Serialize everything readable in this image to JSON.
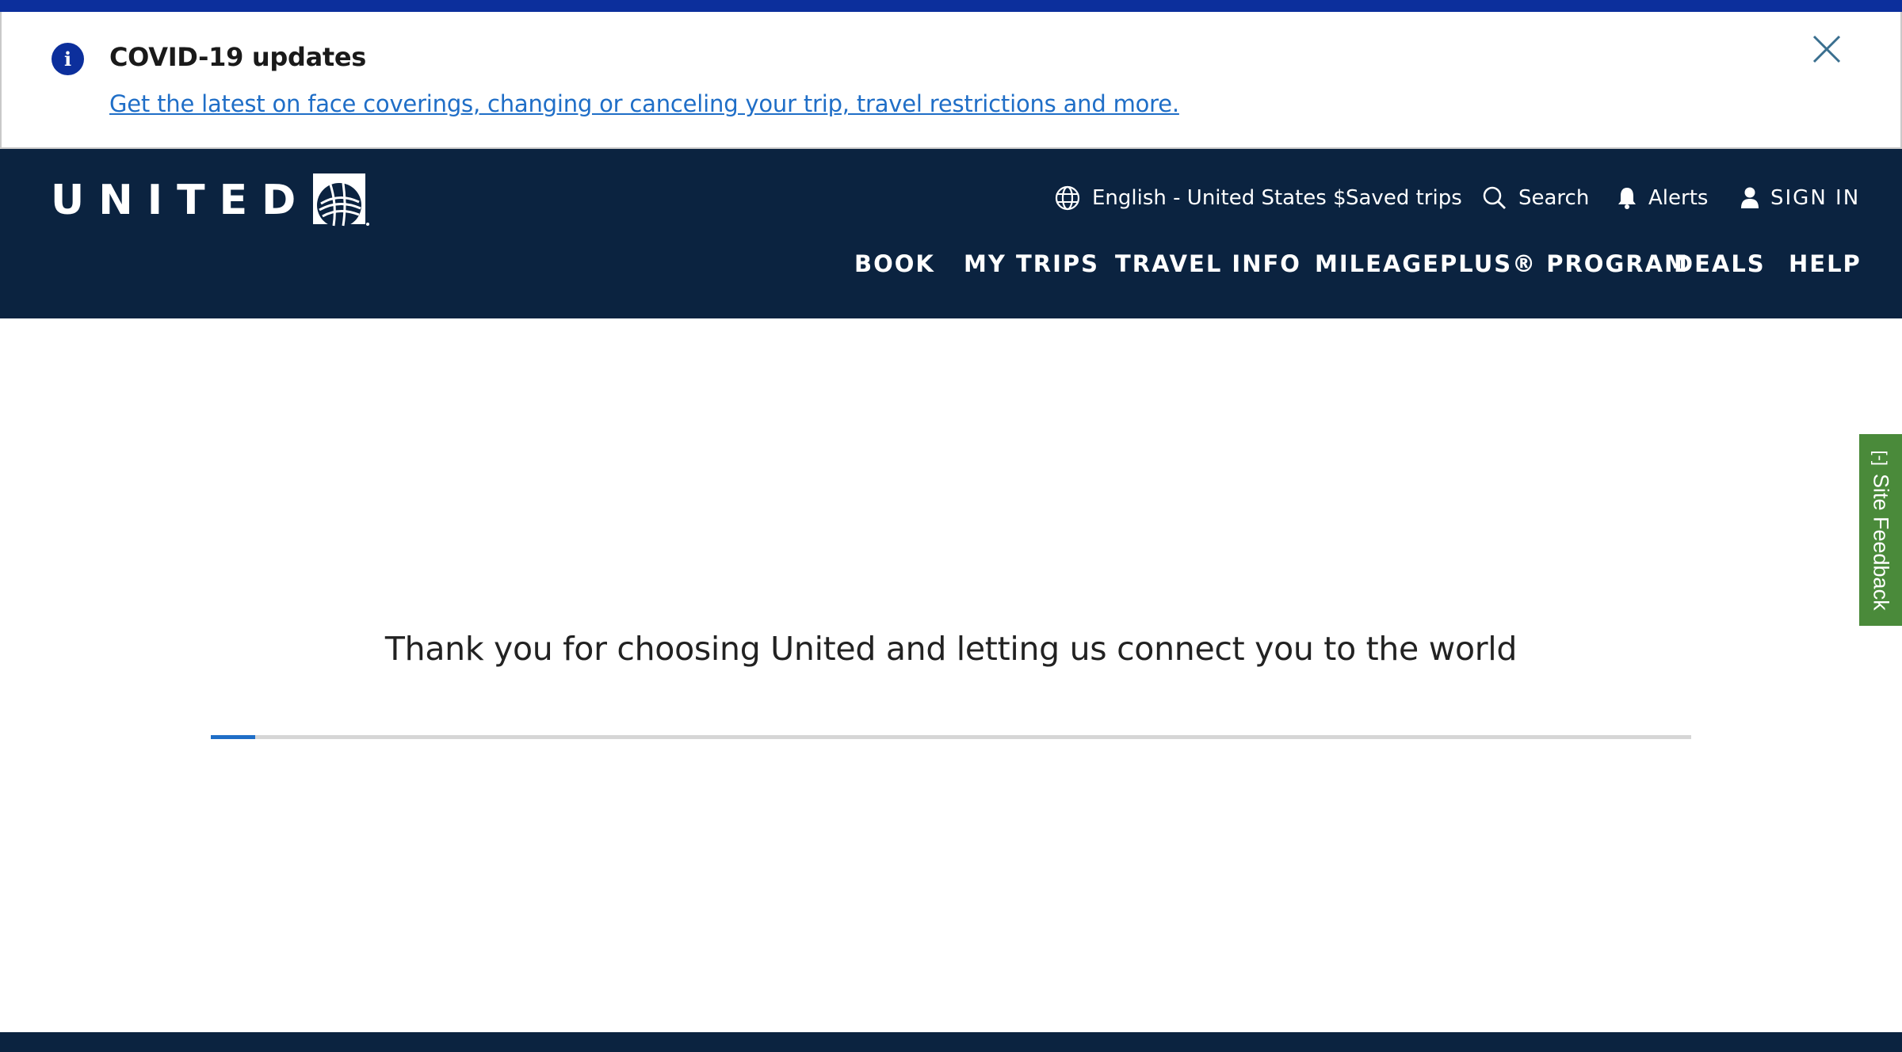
{
  "covid_banner": {
    "title": "COVID-19 updates",
    "link_text": "Get the latest on face coverings, changing or canceling your trip, travel restrictions and more.",
    "info_icon": "info-icon",
    "close_icon": "close-icon",
    "info_glyph": "i"
  },
  "header": {
    "logo_text": "UNITED",
    "utility_nav": [
      {
        "label": "English - United States $",
        "icon": "globe-icon"
      },
      {
        "label": "Saved trips"
      },
      {
        "label": "Search",
        "icon": "search-icon"
      },
      {
        "label": "Alerts",
        "icon": "bell-icon"
      },
      {
        "label": "SIGN IN",
        "icon": "user-icon"
      }
    ],
    "main_nav": [
      "BOOK",
      "MY TRIPS",
      "TRAVEL INFO",
      "MILEAGEPLUS® PROGRAM",
      "DEALS",
      "HELP"
    ]
  },
  "feedback_tab": {
    "label": "Site Feedback",
    "icon_glyph": "[-]"
  },
  "main": {
    "message": "Thank you for choosing United and letting us connect you to the world",
    "progress_fraction": 0.03
  },
  "colors": {
    "top_bar": "#0c2f9c",
    "header_bg": "#0b2340",
    "link": "#1f6ec7",
    "feedback_bg": "#4a8a3a"
  }
}
